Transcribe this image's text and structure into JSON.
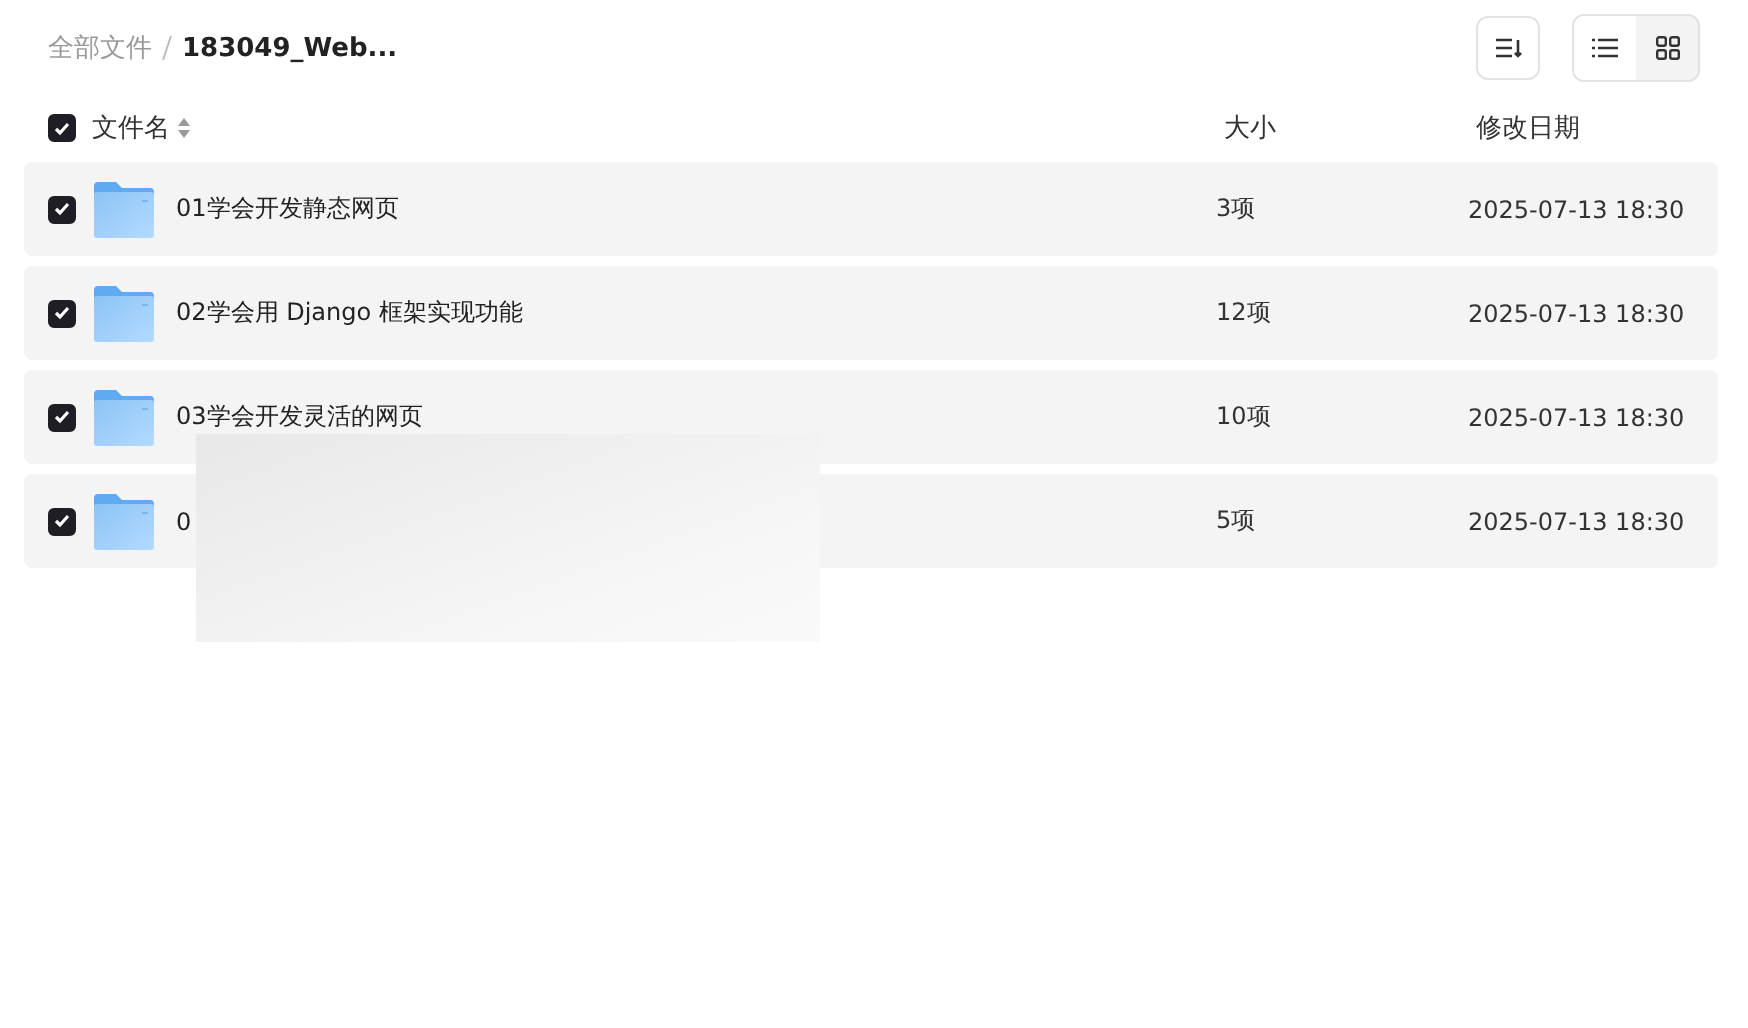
{
  "breadcrumb": [
    {
      "label": "全部文件",
      "current": false
    },
    {
      "label": "183049_Web...",
      "current": true
    }
  ],
  "view_modes": [
    {
      "kind": "list",
      "selected": true
    },
    {
      "kind": "grid",
      "selected": false
    }
  ],
  "columns": {
    "name": "文件名",
    "size": "大小",
    "date": "修改日期"
  },
  "select_all": {
    "checked": true
  },
  "rows": [
    {
      "name": "01学会开发静态网页",
      "size": "3项",
      "date": "2025-07-13 18:30",
      "checked": true
    },
    {
      "name": "02学会用 Django 框架实现功能",
      "size": "12项",
      "date": "2025-07-13 18:30",
      "checked": true
    },
    {
      "name": "03学会开发灵活的网页",
      "size": "10项",
      "date": "2025-07-13 18:30",
      "checked": true
    },
    {
      "name": "0",
      "size": "5项",
      "date": "2025-07-13 18:30",
      "checked": true
    }
  ]
}
